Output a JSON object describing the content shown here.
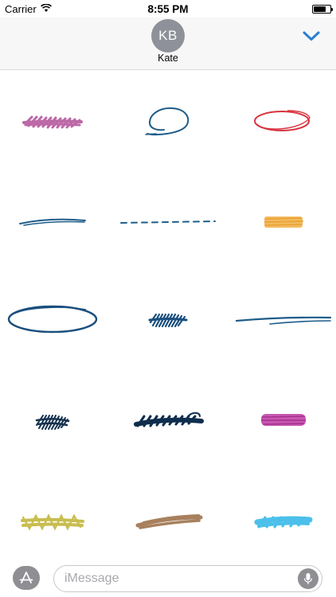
{
  "status_bar": {
    "carrier": "Carrier",
    "time": "8:55 PM"
  },
  "header": {
    "avatar_initials": "KB",
    "contact_name": "Kate"
  },
  "stickers": [
    {
      "name": "pink-scribble-sticker",
      "color": "#b5599e"
    },
    {
      "name": "blue-ellipse-sticker",
      "color": "#1f5d8a"
    },
    {
      "name": "red-ellipse-sticker",
      "color": "#d8343f"
    },
    {
      "name": "blue-underline-sticker",
      "color": "#1f5d8a"
    },
    {
      "name": "blue-dashed-line-sticker",
      "color": "#1f5d8a"
    },
    {
      "name": "yellow-highlight-sticker",
      "color": "#f2b34c"
    },
    {
      "name": "large-blue-ellipse-sticker",
      "color": "#1a4f7e"
    },
    {
      "name": "blue-scribble-sticker",
      "color": "#1a4f7e"
    },
    {
      "name": "blue-double-line-sticker",
      "color": "#1f5d8a"
    },
    {
      "name": "navy-scribble-sticker",
      "color": "#16324f"
    },
    {
      "name": "navy-long-scribble-sticker",
      "color": "#0f2d4d"
    },
    {
      "name": "magenta-scribble-sticker",
      "color": "#c046a8"
    },
    {
      "name": "olive-scribble-sticker",
      "color": "#c8bd4f"
    },
    {
      "name": "brown-highlight-sticker",
      "color": "#a8805e"
    },
    {
      "name": "light-blue-highlight-sticker",
      "color": "#4cc0ea"
    }
  ],
  "input_bar": {
    "placeholder": "iMessage"
  },
  "colors": {
    "accent": "#1a7de0",
    "chevron": "#2a7fd4"
  }
}
